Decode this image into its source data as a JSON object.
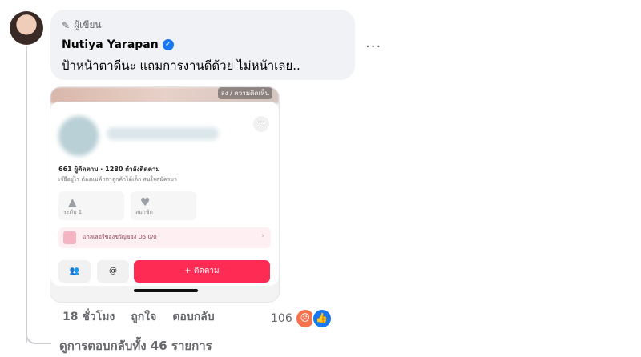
{
  "comment": {
    "badge_label": "ผู้เขียน",
    "author_name": "Nutiya Yarapan",
    "text": "ป้าหน้าตาดีนะ แถมการงานดีด้วย ไม่หน้าเลย..",
    "more_label": "···"
  },
  "attachment": {
    "top_label": "ลง / ความคิดเห็น",
    "card_more": "···",
    "stats_text": "661 ผู้ติดตาม · 1280 กำลังติดตาม",
    "bio_text": "เจ๊ยีอยู่ไร ต้องแม่ค้าหาลูกค้าได้เด็ก สนใจสมัครมา",
    "tile_left_label": "ระดับ 1",
    "tile_right_label": "สมาชิก",
    "gift_label": "แกลเลอรีของขวัญของ D5  0/0",
    "gift_right": "›",
    "friends_btn": "👥",
    "mention_btn": "@",
    "follow_btn": "+ ติดตาม"
  },
  "meta": {
    "time": "18 ชั่วโมง",
    "like_label": "ถูกใจ",
    "reply_label": "ตอบกลับ",
    "reaction_count": "106"
  },
  "replies": {
    "label": "ดูการตอบกลับทั้ง 46 รายการ"
  },
  "icons": {
    "badge": "pen-icon",
    "verified": "verified-check-icon",
    "angry": "angry-reaction-icon",
    "like": "like-reaction-icon"
  },
  "colors": {
    "bubble": "#f0f2f5",
    "verified": "#1877f2",
    "follow": "#fe2c55",
    "meta_text": "#65676b"
  }
}
